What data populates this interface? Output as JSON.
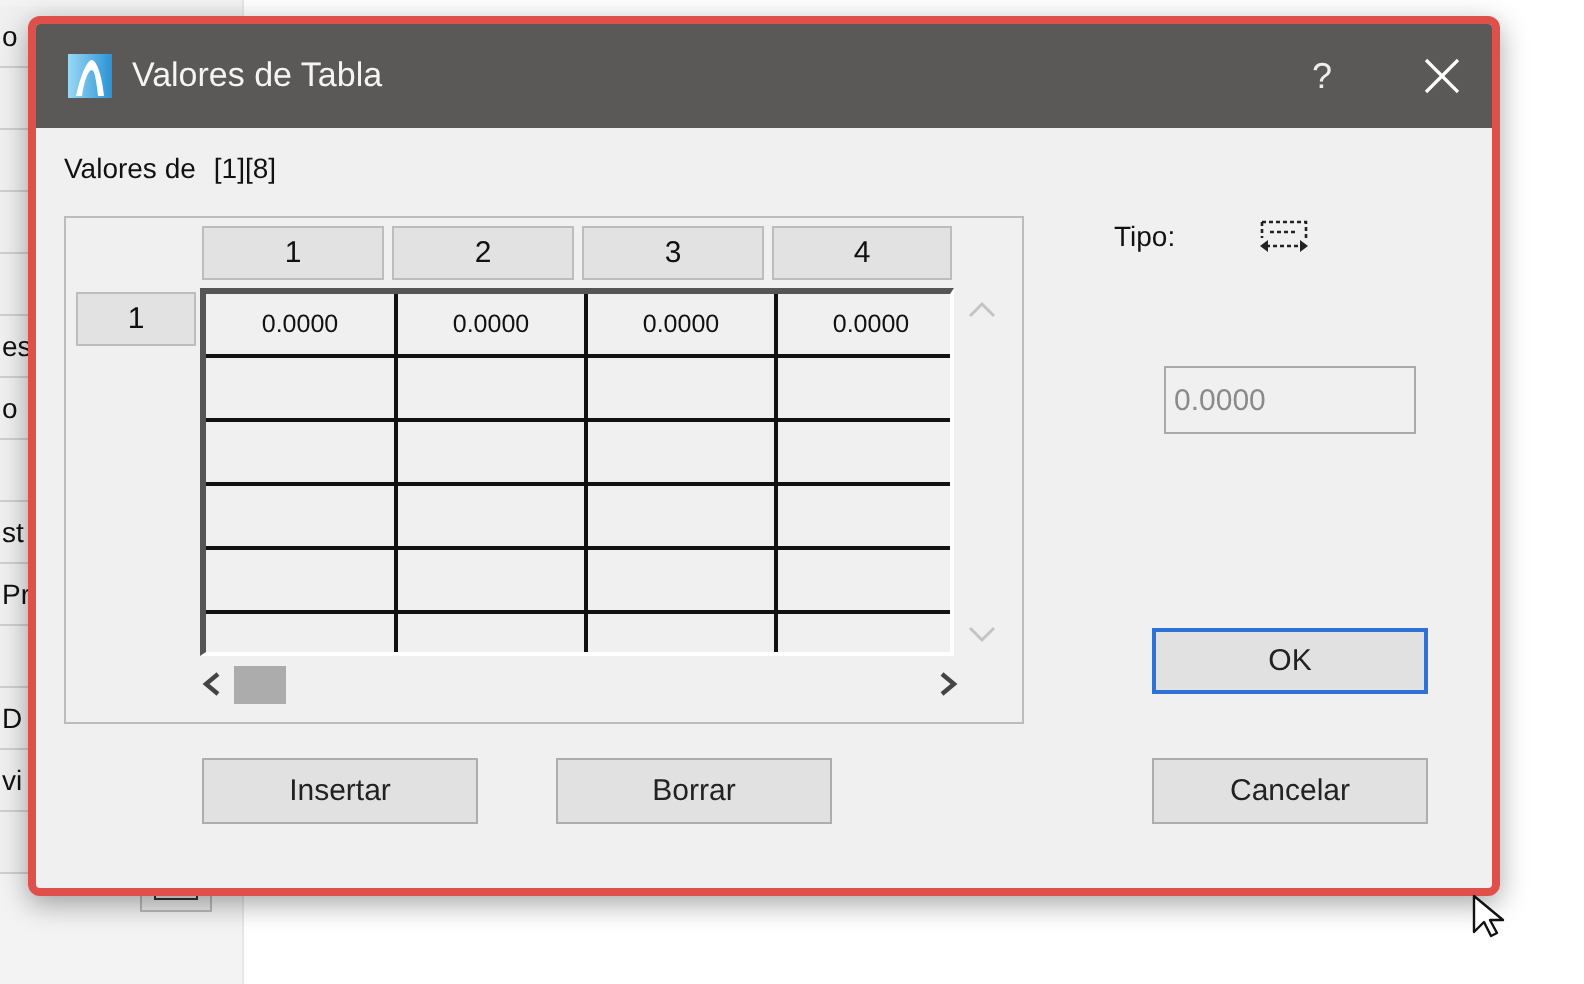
{
  "background_panel": {
    "items": [
      "o",
      "es",
      "o",
      "st",
      "Pr",
      "D",
      "vi"
    ]
  },
  "dialog": {
    "title": "Valores de Tabla",
    "help": "?",
    "label": "Valores de",
    "index": "[1][8]",
    "table": {
      "columns": [
        "1",
        "2",
        "3",
        "4"
      ],
      "rows": [
        {
          "header": "1",
          "cells": [
            "0.0000",
            "0.0000",
            "0.0000",
            "0.0000"
          ]
        }
      ]
    },
    "type_label": "Tipo:",
    "value_field": {
      "value": "0.0000",
      "disabled": true
    },
    "table_buttons": [
      {
        "label": "Insertar",
        "default": false
      },
      {
        "label": "Borrar",
        "default": false
      }
    ],
    "dialog_buttons": [
      {
        "label": "OK",
        "default": true
      },
      {
        "label": "Cancelar",
        "default": false
      }
    ]
  }
}
